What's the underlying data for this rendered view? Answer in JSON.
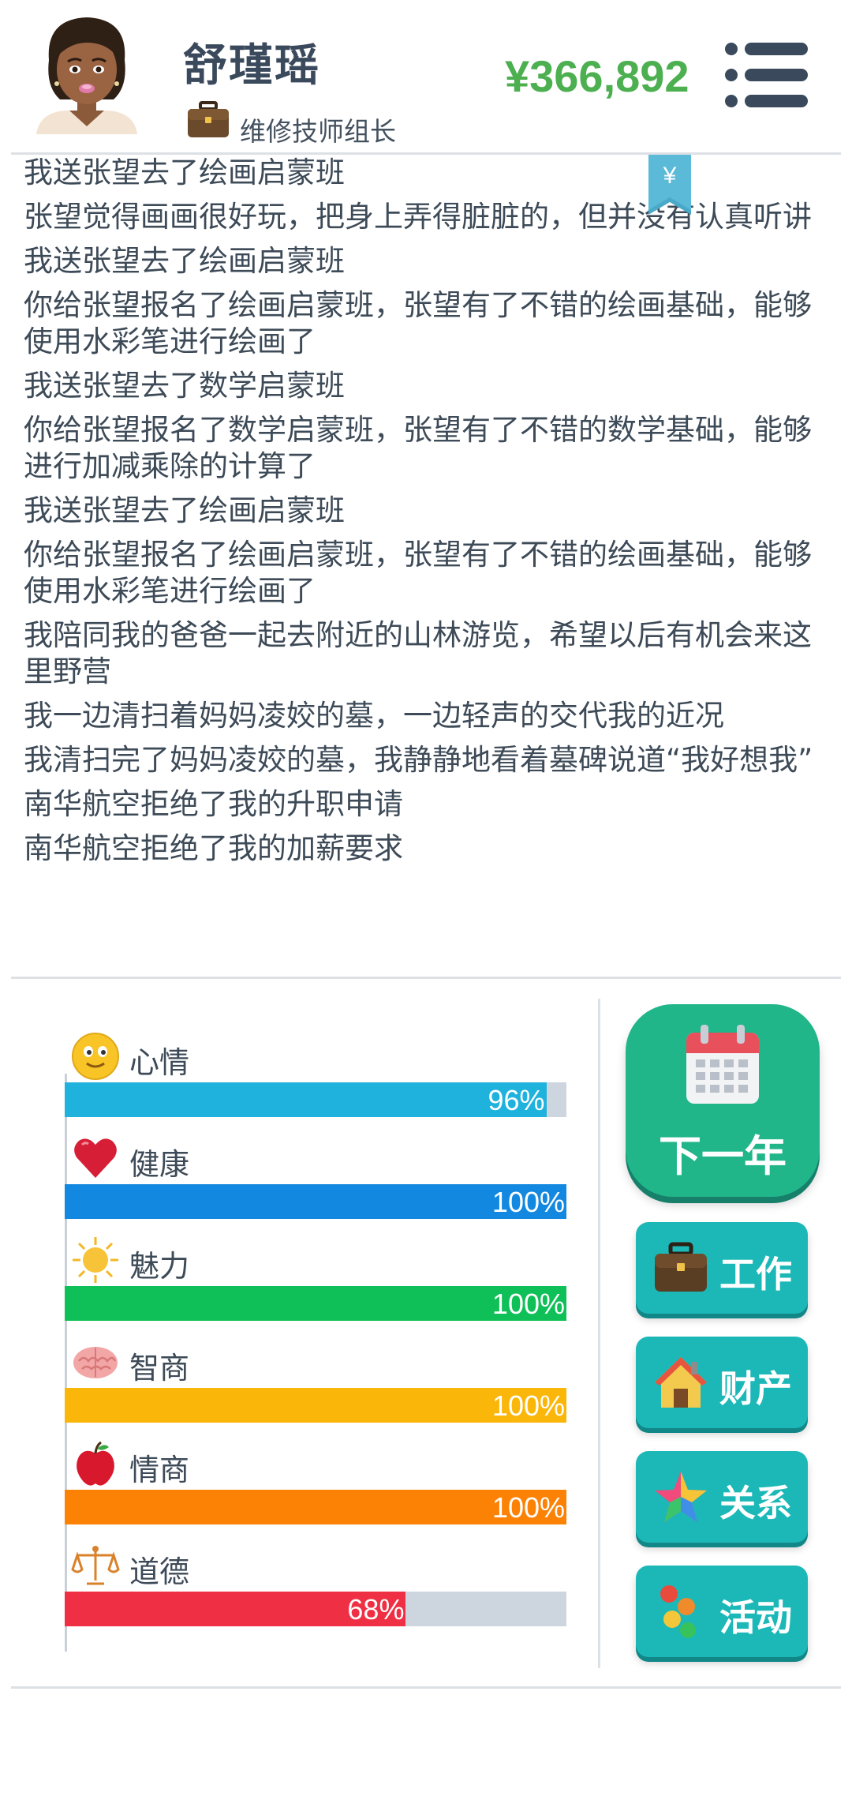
{
  "header": {
    "name": "舒瑾瑶",
    "job_title": "维修技师组长",
    "money": "¥366,892"
  },
  "bookmark_symbol": "¥",
  "log": [
    "我送张望去了绘画启蒙班",
    "张望觉得画画很好玩，把身上弄得脏脏的，但并没有认真听讲",
    "我送张望去了绘画启蒙班",
    "你给张望报名了绘画启蒙班，张望有了不错的绘画基础，能够使用水彩笔进行绘画了",
    "我送张望去了数学启蒙班",
    "你给张望报名了数学启蒙班，张望有了不错的数学基础，能够进行加减乘除的计算了",
    "我送张望去了绘画启蒙班",
    "你给张望报名了绘画启蒙班，张望有了不错的绘画基础，能够使用水彩笔进行绘画了",
    "我陪同我的爸爸一起去附近的山林游览，希望以后有机会来这里野营",
    "我一边清扫着妈妈凌姣的墓，一边轻声的交代我的近况",
    "我清扫完了妈妈凌姣的墓，我静静地看着墓碑说道“我好想我”",
    "南华航空拒绝了我的升职申请",
    "南华航空拒绝了我的加薪要求"
  ],
  "stats": [
    {
      "label": "心情",
      "value": 96,
      "display": "96%",
      "color": "#1fb2dd",
      "icon": "smiley-icon"
    },
    {
      "label": "健康",
      "value": 100,
      "display": "100%",
      "color": "#1288e0",
      "icon": "heart-icon"
    },
    {
      "label": "魅力",
      "value": 100,
      "display": "100%",
      "color": "#0fbf57",
      "icon": "sun-icon"
    },
    {
      "label": "智商",
      "value": 100,
      "display": "100%",
      "color": "#fbb60a",
      "icon": "brain-icon"
    },
    {
      "label": "情商",
      "value": 100,
      "display": "100%",
      "color": "#fc8206",
      "icon": "apple-icon"
    },
    {
      "label": "道德",
      "value": 68,
      "display": "68%",
      "color": "#ef3044",
      "icon": "scales-icon"
    }
  ],
  "buttons": {
    "next_year": "下一年",
    "work": "工作",
    "property": "财产",
    "relations": "关系",
    "activities": "活动"
  }
}
